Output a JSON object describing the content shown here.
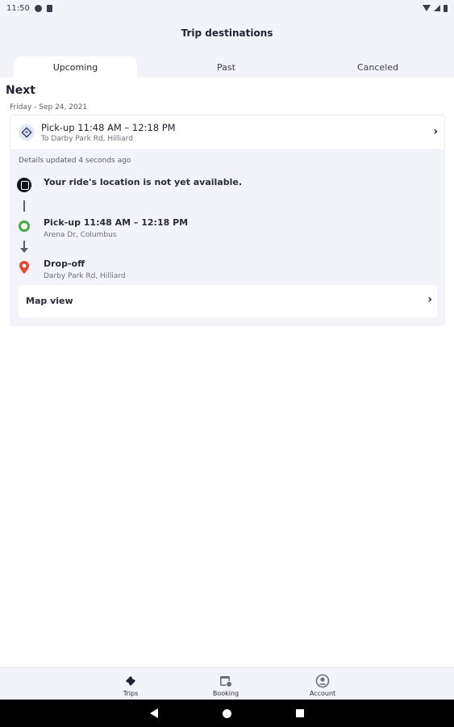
{
  "status_bar": {
    "time": "11:50"
  },
  "header": {
    "title": "Trip destinations",
    "tabs": [
      {
        "label": "Upcoming",
        "active": true
      },
      {
        "label": "Past",
        "active": false
      },
      {
        "label": "Canceled",
        "active": false
      }
    ]
  },
  "main": {
    "section_heading": "Next",
    "date": "Friday - Sep 24, 2021",
    "trip": {
      "title": "Pick-up 11:48 AM – 12:18 PM",
      "subtitle": "To Darby Park Rd, Hilliard"
    },
    "details_updated": "Details updated 4 seconds ago",
    "ride_location": "Your ride's location is not yet available.",
    "pickup": {
      "title": "Pick-up 11:48 AM – 12:18 PM",
      "address": "Arena Dr, Columbus"
    },
    "dropoff": {
      "title": "Drop-off",
      "address": "Darby Park Rd, Hilliard"
    },
    "map_view_label": "Map view"
  },
  "bottom_nav": [
    {
      "label": "Trips",
      "icon": "ticket-icon"
    },
    {
      "label": "Booking",
      "icon": "calendar-icon"
    },
    {
      "label": "Account",
      "icon": "account-icon"
    }
  ],
  "colors": {
    "header_bg": "#f3f4fa",
    "pickup_green": "#3dae3d",
    "dropoff_red": "#e8462f",
    "text_dark": "#1f2230"
  }
}
